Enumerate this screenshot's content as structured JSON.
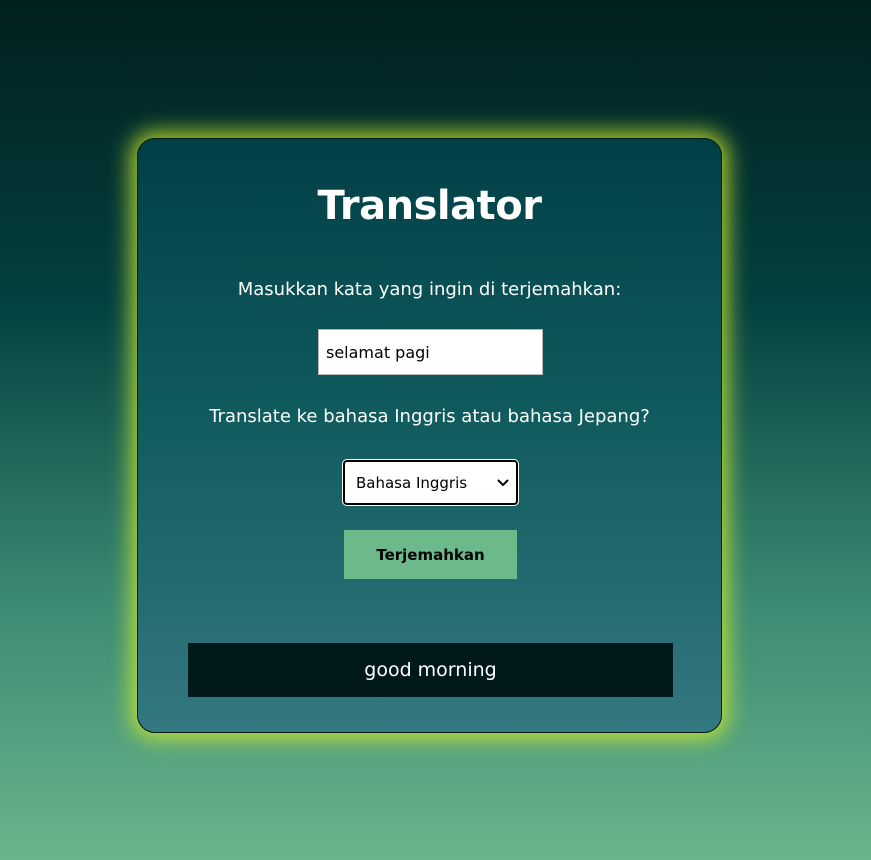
{
  "app": {
    "title": "Translator"
  },
  "form": {
    "input_label": "Masukkan kata yang ingin di terjemahkan:",
    "input_value": "selamat pagi",
    "select_label": "Translate ke bahasa Inggris atau bahasa Jepang?",
    "select_value": "Bahasa Inggris",
    "submit_label": "Terjemahkan"
  },
  "result": {
    "text": "good morning"
  },
  "icons": {
    "select_arrow": "chevron-down-icon"
  },
  "colors": {
    "card_glow": "#cdeb28",
    "button_bg": "#6cba8c",
    "result_bg": "#02191b"
  }
}
